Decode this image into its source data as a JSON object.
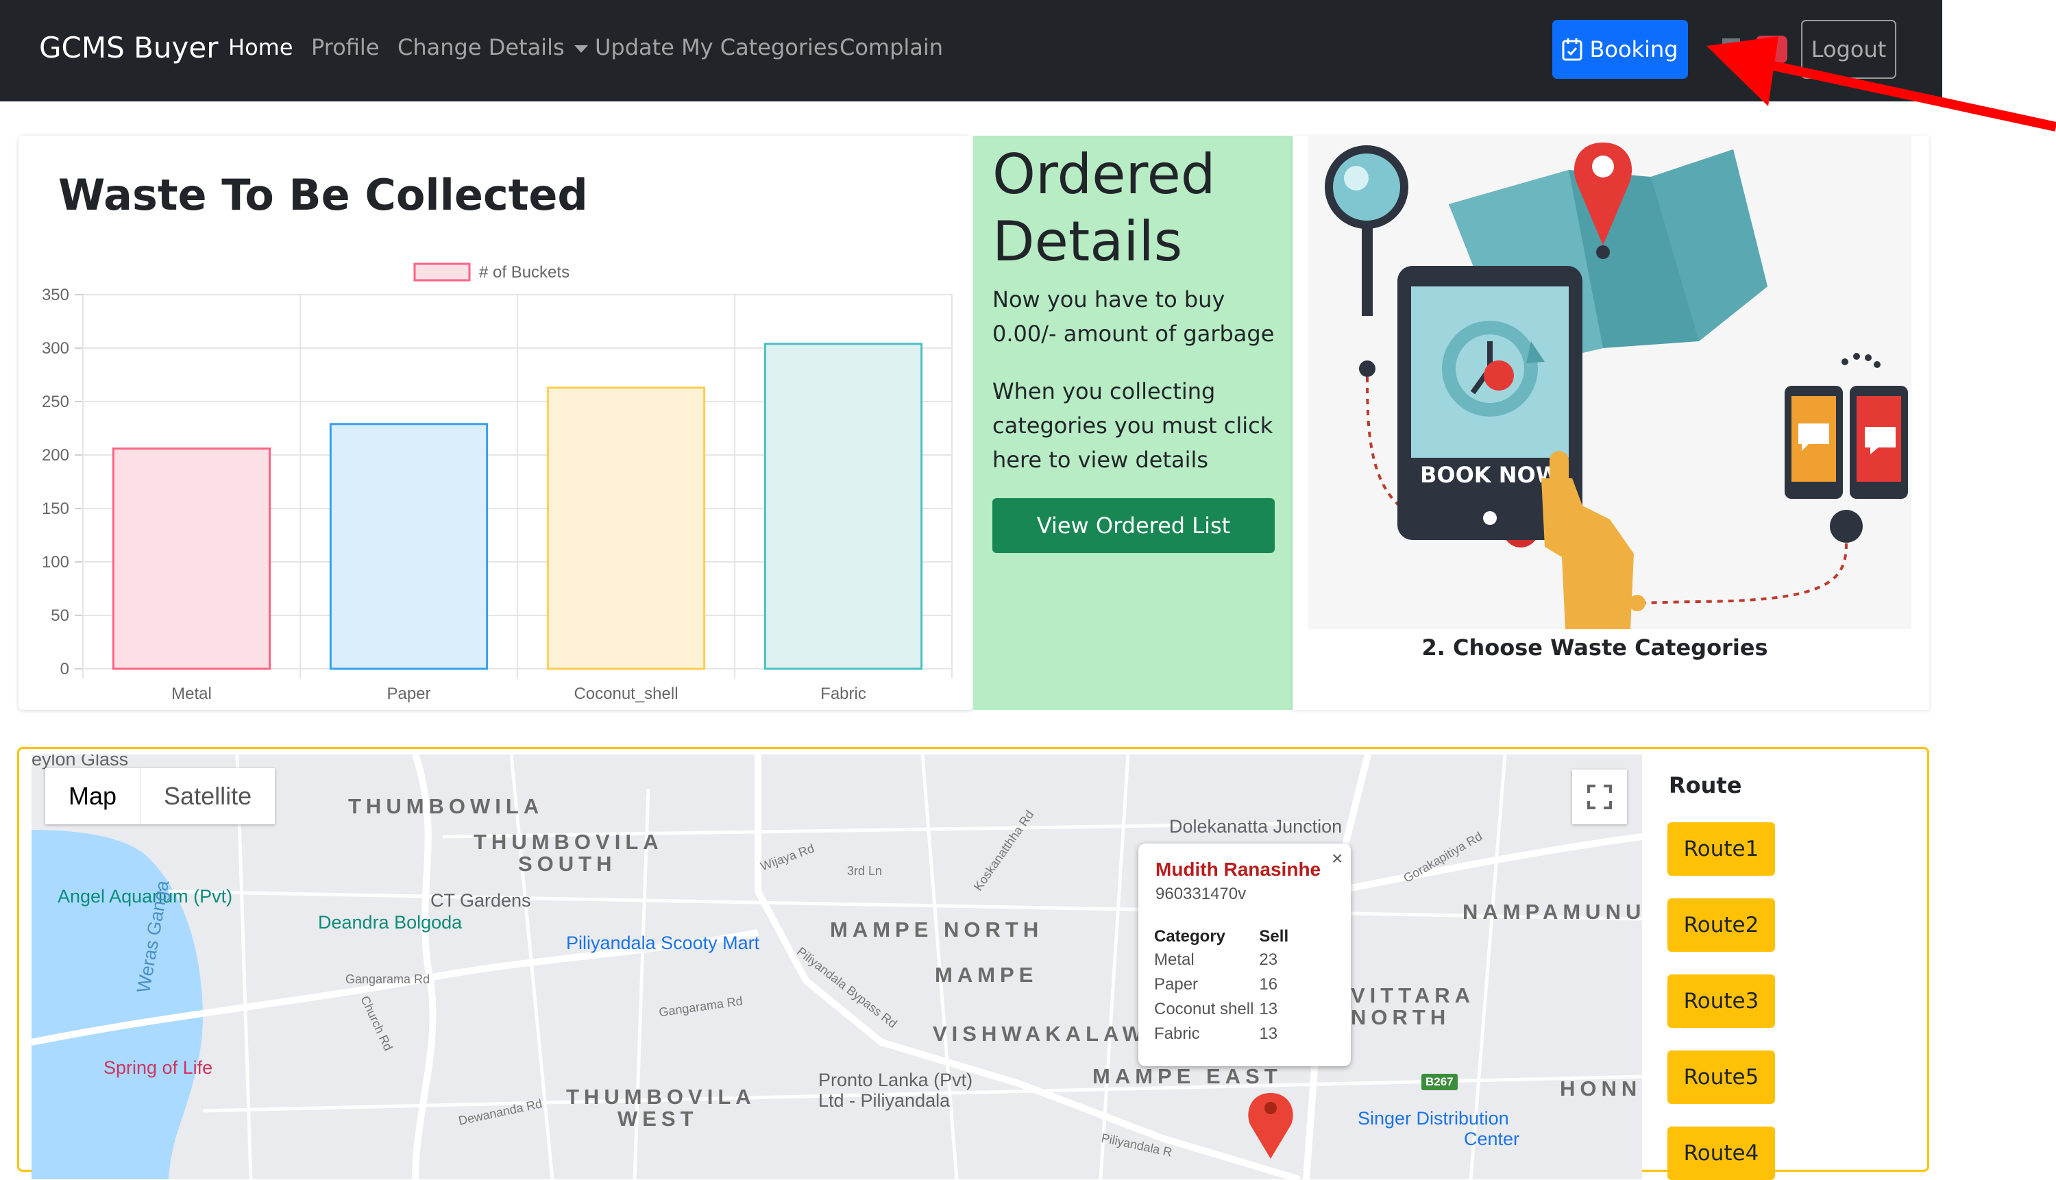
{
  "navbar": {
    "brand": "GCMS Buyer",
    "links": [
      "Home",
      "Profile",
      "Change Details",
      "Update My Categories",
      "Complain"
    ],
    "booking_label": "Booking",
    "cart_count": "0",
    "logout_label": "Logout"
  },
  "chart_card": {
    "title": "Waste To Be Collected"
  },
  "chart_data": {
    "type": "bar",
    "categories": [
      "Metal",
      "Paper",
      "Coconut_shell",
      "Fabric"
    ],
    "series": [
      {
        "name": "# of Buckets",
        "values": [
          206,
          229,
          263,
          304
        ]
      }
    ],
    "ylim": [
      0,
      350
    ],
    "yticks": [
      "0",
      "50",
      "100",
      "150",
      "200",
      "250",
      "300",
      "350"
    ],
    "colors": {
      "fill": [
        "#fde0e6",
        "#dbeefb",
        "#fff2d6",
        "#dff0f0"
      ],
      "stroke": [
        "#ff6384",
        "#36a2eb",
        "#ffcd56",
        "#4bc0c0"
      ]
    },
    "legend": "top",
    "grid": true
  },
  "ordered": {
    "title": "Ordered Details",
    "text1": "Now you have to buy 0.00/- amount of garbage",
    "text2": "When you collecting categories you must click here to view details",
    "button": "View Ordered List"
  },
  "illustration": {
    "caption": "2. Choose Waste Categories",
    "screen_text": "BOOK NOW"
  },
  "map": {
    "type_map": "Map",
    "type_satellite": "Satellite",
    "popup": {
      "name": "Mudith Ranasinhe",
      "id": "960331470v",
      "headers": [
        "Category",
        "Sell"
      ],
      "rows": [
        [
          "Metal",
          "23"
        ],
        [
          "Paper",
          "16"
        ],
        [
          "Coconut shell",
          "13"
        ],
        [
          "Fabric",
          "13"
        ]
      ]
    },
    "labels": {
      "thumbowila": "THUMBOWILA",
      "thumbovila_south_1": "THUMBOVILA",
      "thumbovila_south_2": "SOUTH",
      "mampe_north": "MAMPE NORTH",
      "mampe": "MAMPE",
      "vishwakalawa": "VISHWAKALAW",
      "mampe_east": "MAMPE EAST",
      "vittara_1": "VITTARA",
      "vittara_2": "NORTH",
      "nampamunu": "NAMPAMUNU",
      "thumbovila_west_1": "THUMBOVILA",
      "thumbovila_west_2": "WEST",
      "honn": "HONN",
      "angel": "Angel Aquarium (Pvt)",
      "deandra": "Deandra Bolgoda",
      "ct": "CT Gardens",
      "scooty": "Piliyandala Scooty Mart",
      "spring": "Spring of Life",
      "pronto_1": "Pronto Lanka (Pvt)",
      "pronto_2": "Ltd - Piliyandala",
      "dolekanatta": "Dolekanatta Junction",
      "singer_1": "Singer Distribution",
      "singer_2": "Center",
      "weras": "Weras Ganga",
      "road_gangarama": "Gangarama Rd",
      "road_gangarama2": "Gangarama Rd",
      "road_bypass": "Piliyandala Bypass Rd",
      "road_wijaya": "Wijaya Rd",
      "road_3rd": "3rd Ln",
      "road_church": "Church Rd",
      "road_dewananda": "Dewananda Rd",
      "road_gorakapitiya": "Gorakapitiya Rd",
      "road_kosakanattha": "Koskanatthha Rd",
      "road_piliyandala": "Piliyandala R",
      "road_b267": "B267",
      "ceylon": "eylon Glass"
    }
  },
  "routes": {
    "title": "Route",
    "buttons": [
      "Route1",
      "Route2",
      "Route3",
      "Route5",
      "Route4"
    ]
  }
}
